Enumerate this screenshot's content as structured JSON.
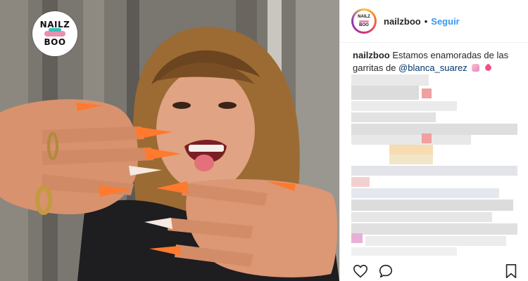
{
  "logo": {
    "line1": "NAILZ",
    "line2": "BOO"
  },
  "avatar": {
    "line1": "NAILZ",
    "line2": "BOO"
  },
  "header": {
    "username": "nailzboo",
    "separator": "•",
    "follow_label": "Seguir"
  },
  "caption": {
    "username": "nailzboo",
    "text": "Estamos enamoradas de las garritas de",
    "mention": "@blanca_suarez"
  },
  "icons": {
    "like": "heart-icon",
    "comment": "comment-icon",
    "save": "bookmark-icon"
  },
  "colors": {
    "link": "#3897f0",
    "mention": "#003569",
    "text": "#262626",
    "nail_orange": "#ff7a2e"
  }
}
